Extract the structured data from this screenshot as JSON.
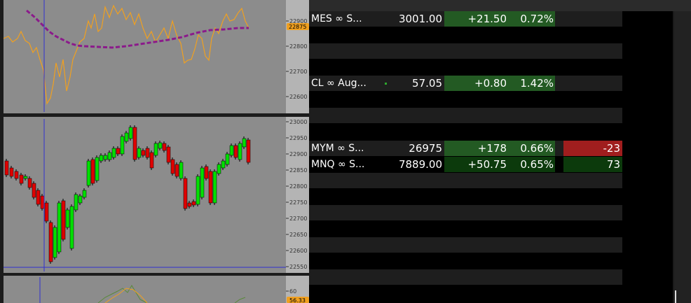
{
  "colors": {
    "up_candle": "#00e000",
    "down_candle": "#e00000",
    "ma_line": "#8b1a8b",
    "osc_line": "#f0a020",
    "crosshair": "#3030d0",
    "panel_bg": "#8c8c8c",
    "positive_bg": "#235a23",
    "negative_bg": "#a01e1e"
  },
  "chart_top": {
    "y_ticks": [
      "22900",
      "22800",
      "22700",
      "22600"
    ],
    "price_tag": "22875"
  },
  "chart_mid": {
    "y_ticks": [
      "23000",
      "22950",
      "22900",
      "22850",
      "22800",
      "22750",
      "22700",
      "22650",
      "22600",
      "22550"
    ]
  },
  "chart_bottom": {
    "y_ticks": [
      "60"
    ],
    "price_tag": "56.33"
  },
  "watchlist": {
    "rows": [
      {
        "symbol": "MES ∞ S...",
        "last": "3001.00",
        "change": "+21.50",
        "percent": "0.72%",
        "position": ""
      },
      {
        "symbol": "",
        "last": "",
        "change": "",
        "percent": "",
        "position": ""
      },
      {
        "symbol": "",
        "last": "",
        "change": "",
        "percent": "",
        "position": ""
      },
      {
        "symbol": "",
        "last": "",
        "change": "",
        "percent": "",
        "position": ""
      },
      {
        "symbol": "CL ∞ Aug...",
        "last": "57.05",
        "change": "+0.80",
        "percent": "1.42%",
        "position": ""
      },
      {
        "symbol": "",
        "last": "",
        "change": "",
        "percent": "",
        "position": ""
      },
      {
        "symbol": "",
        "last": "",
        "change": "",
        "percent": "",
        "position": ""
      },
      {
        "symbol": "",
        "last": "",
        "change": "",
        "percent": "",
        "position": ""
      },
      {
        "symbol": "MYM ∞ S...",
        "last": "26975",
        "change": "+178",
        "percent": "0.66%",
        "position": "-23"
      },
      {
        "symbol": "MNQ ∞ S...",
        "last": "7889.00",
        "change": "+50.75",
        "percent": "0.65%",
        "position": "73"
      }
    ]
  }
}
